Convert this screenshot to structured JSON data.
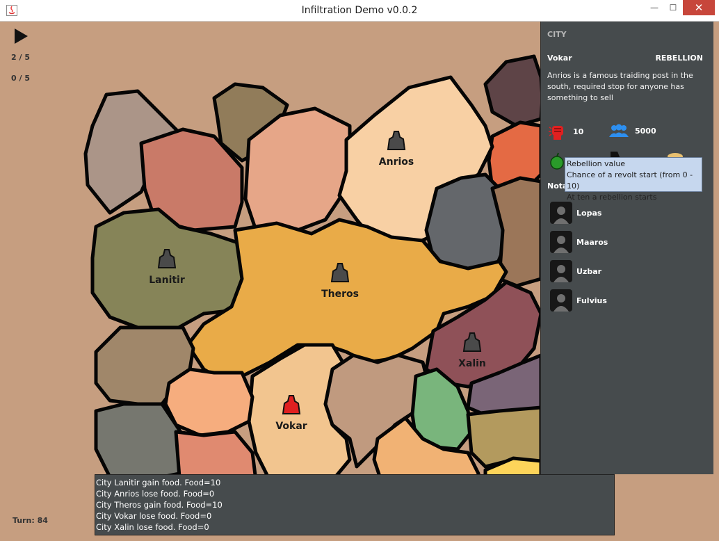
{
  "window": {
    "title": "Infiltration Demo v0.0.2",
    "minimize_glyph": "—",
    "maximize_glyph": "☐",
    "close_glyph": "✕"
  },
  "hud": {
    "counter_top": "2 / 5",
    "counter_bottom": "0 / 5",
    "turn": "Turn: 84",
    "play_icon": "play-icon"
  },
  "map": {
    "cities": [
      {
        "name": "Anrios",
        "icon_color": "#4a4a4a"
      },
      {
        "name": "Lanitir",
        "icon_color": "#4a4a4a"
      },
      {
        "name": "Theros",
        "icon_color": "#4a4a4a"
      },
      {
        "name": "Xalin",
        "icon_color": "#4a4a4a"
      },
      {
        "name": "Vokar",
        "icon_color": "#e02020"
      }
    ]
  },
  "panel": {
    "heading": "CITY",
    "city_name": "Vokar",
    "state": "REBELLION",
    "description": "Anrios is a famous traiding post in the south, required stop for anyone has something to sell",
    "rebellion_value": "10",
    "population": "5000",
    "notables_label": "Nota",
    "notables": [
      {
        "name": "Lopas"
      },
      {
        "name": "Maaros"
      },
      {
        "name": "Uzbar"
      },
      {
        "name": "Fulvius"
      }
    ]
  },
  "tooltip": {
    "line1": "Rebellion value",
    "line2": "Chance of a revolt start (from 0 - 10)",
    "line3": "At ten a rebellion starts"
  },
  "log": {
    "lines": [
      "City Lanitir gain food. Food=10",
      "City Anrios lose food. Food=0",
      "City Theros gain food. Food=10",
      "City Vokar lose food. Food=0",
      "City Xalin lose food. Food=0"
    ]
  },
  "colors": {
    "background": "#c69e80",
    "panel": "#464b4d",
    "theros": "#e9ab48",
    "lanitir": "#868458",
    "anrios": "#f8d0a4",
    "vokar": "#f2c58f",
    "xalin": "#8f5158"
  }
}
